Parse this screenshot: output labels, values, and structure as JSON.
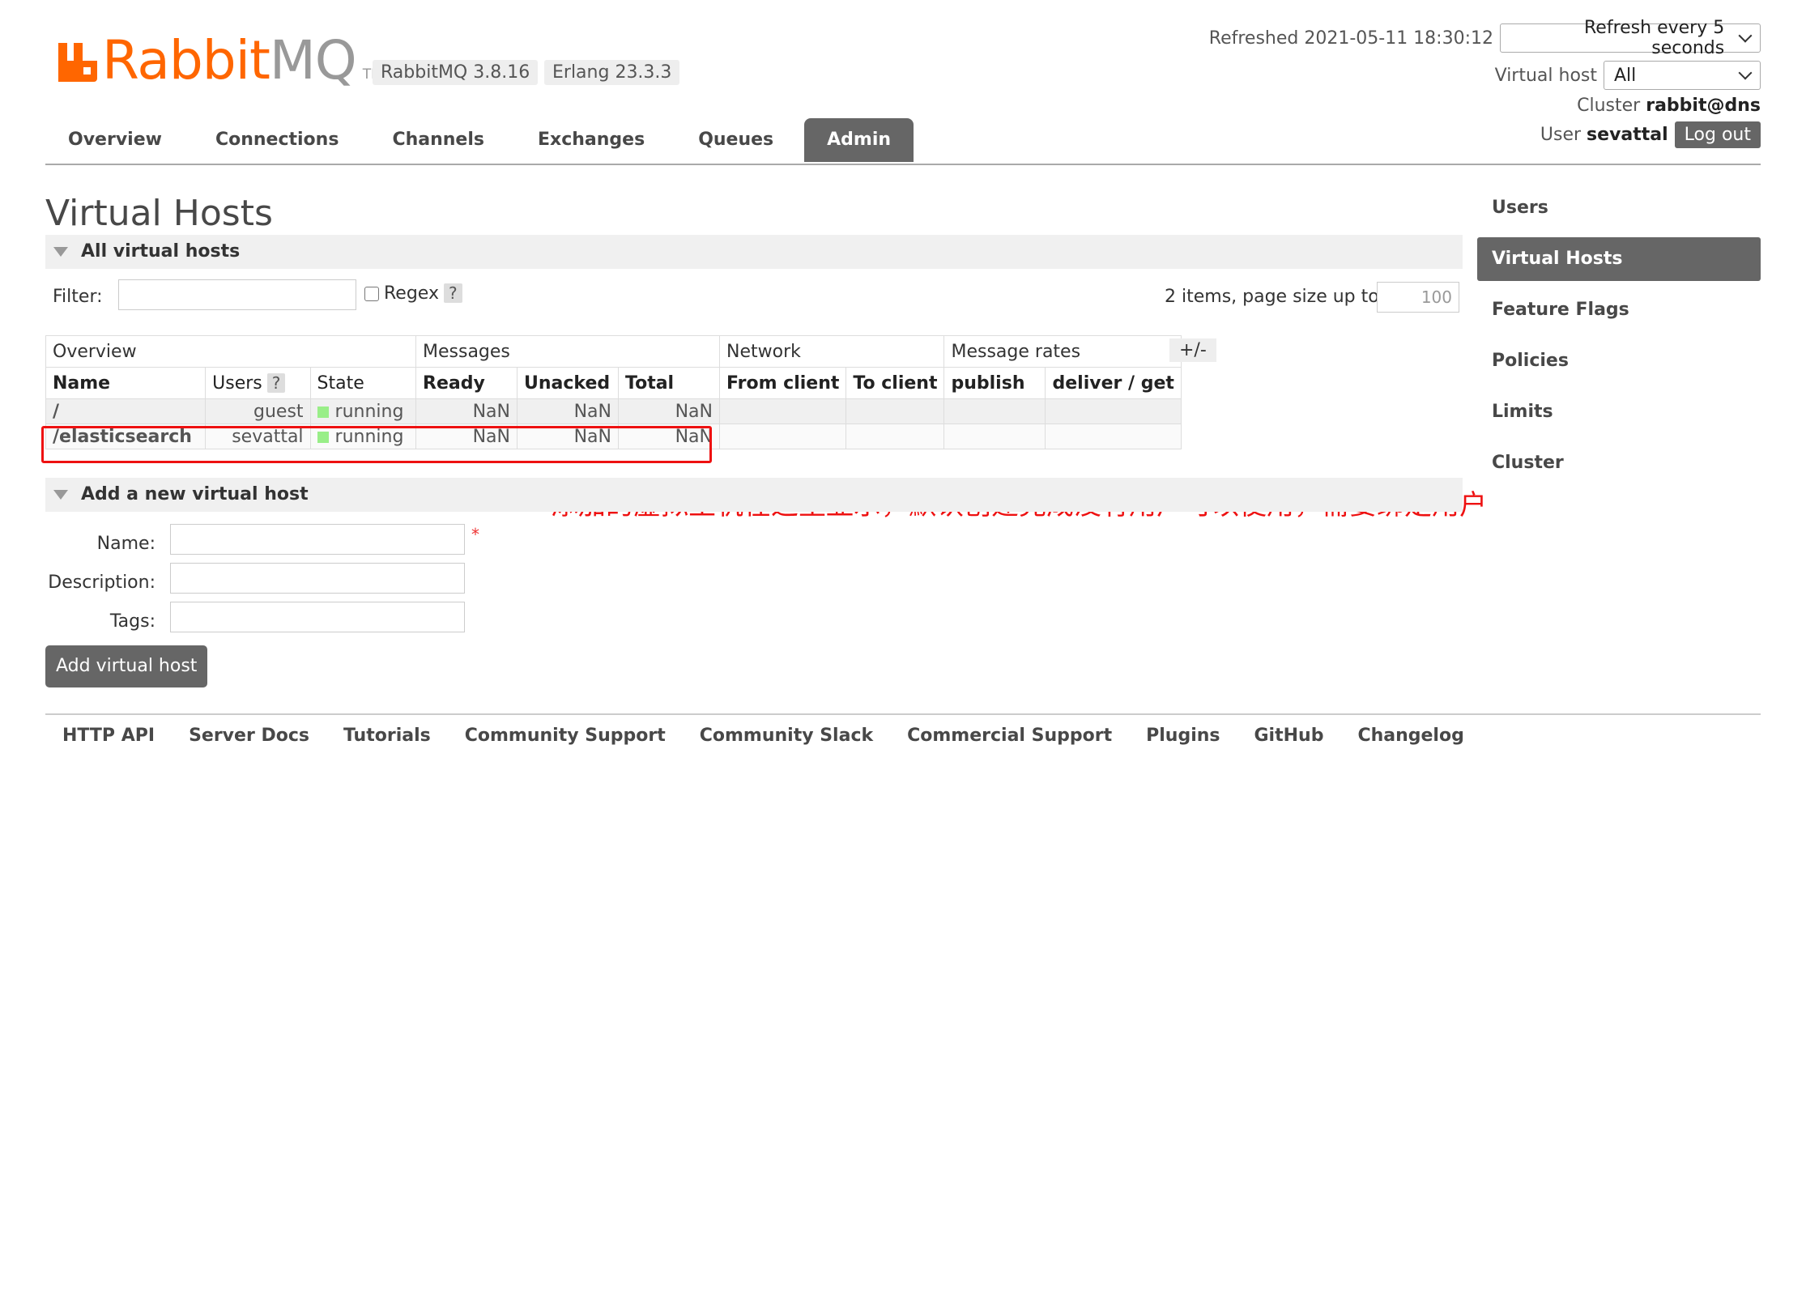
{
  "brand": {
    "logo_text_rabbit": "Rabbit",
    "logo_text_mq": "MQ",
    "logo_tm": "TM",
    "version_badge": "RabbitMQ 3.8.16",
    "erlang_badge": "Erlang 23.3.3",
    "accent_color": "#ff6600"
  },
  "status": {
    "refreshed": "Refreshed 2021-05-11 18:30:12",
    "refresh_select": "Refresh every 5 seconds",
    "vhost_label": "Virtual host",
    "vhost_select": "All",
    "cluster_label": "Cluster",
    "cluster_name": "rabbit@dns",
    "user_label": "User",
    "user_name": "sevattal",
    "logout": "Log out"
  },
  "nav": {
    "tabs": [
      {
        "label": "Overview"
      },
      {
        "label": "Connections"
      },
      {
        "label": "Channels"
      },
      {
        "label": "Exchanges"
      },
      {
        "label": "Queues"
      },
      {
        "label": "Admin",
        "active": true
      }
    ]
  },
  "side_nav": {
    "items": [
      {
        "label": "Users"
      },
      {
        "label": "Virtual Hosts",
        "active": true
      },
      {
        "label": "Feature Flags"
      },
      {
        "label": "Policies"
      },
      {
        "label": "Limits"
      },
      {
        "label": "Cluster"
      }
    ]
  },
  "page": {
    "title": "Virtual Hosts",
    "all_vhosts_heading": "All virtual hosts",
    "filter_label": "Filter:",
    "regex_label": "Regex",
    "help_mark": "?",
    "pagination_text": "2 items, page size up to",
    "page_size": "100",
    "columns_toggle": "+/-"
  },
  "table": {
    "groups": [
      "Overview",
      "Messages",
      "Network",
      "Message rates"
    ],
    "columns": [
      "Name",
      "Users",
      "State",
      "Ready",
      "Unacked",
      "Total",
      "From client",
      "To client",
      "publish",
      "deliver / get"
    ],
    "rows": [
      {
        "name": "/",
        "users": "guest",
        "state": "running",
        "ready": "NaN",
        "unacked": "NaN",
        "total": "NaN"
      },
      {
        "name": "/elasticsearch",
        "users": "sevattal",
        "state": "running",
        "ready": "NaN",
        "unacked": "NaN",
        "total": "NaN"
      }
    ]
  },
  "annotation": "添加的虚拟主机在这里显示，默认创建完成没有用户可以使用，需要绑定用户",
  "add_form": {
    "heading": "Add a new virtual host",
    "name_label": "Name:",
    "description_label": "Description:",
    "tags_label": "Tags:",
    "required_mark": "*",
    "submit": "Add virtual host"
  },
  "footer": {
    "links": [
      "HTTP API",
      "Server Docs",
      "Tutorials",
      "Community Support",
      "Community Slack",
      "Commercial Support",
      "Plugins",
      "GitHub",
      "Changelog"
    ]
  }
}
